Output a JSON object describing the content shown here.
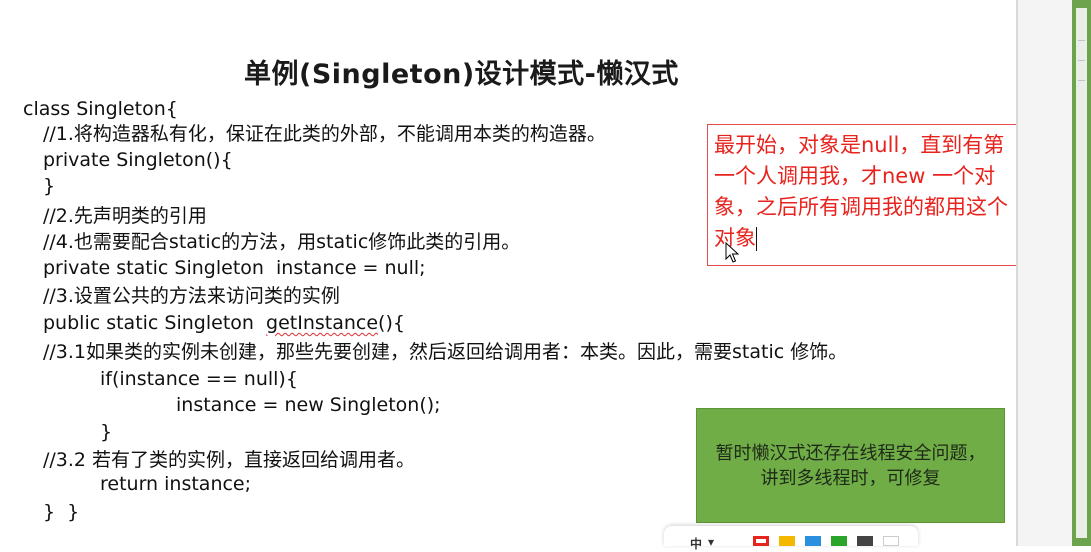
{
  "slide": {
    "title": "单例(Singleton)设计模式-懒汉式",
    "code_lines": [
      "class Singleton{",
      "//1.将构造器私有化，保证在此类的外部，不能调用本类的构造器。",
      "private Singleton(){",
      "}",
      "//2.先声明类的引用",
      "//4.也需要配合static的方法，用static修饰此类的引用。",
      "private static Singleton  instance = null;",
      "//3.设置公共的方法来访问类的实例",
      "public static Singleton  ",
      "getInstance",
      "(){",
      "//3.1如果类的实例未创建，那些先要创建，然后返回给调用者：本类。因此，需要static 修饰。",
      "if(instance == null){",
      "instance = new Singleton();",
      "}",
      "//3.2 若有了类的实例，直接返回给调用者。",
      "return instance;",
      "}  }"
    ]
  },
  "note_box": {
    "lines": [
      "最开始，对象是null，直到有第",
      "一个人调用我，才new 一个对",
      "象，之后所有调用我的都用这个",
      "对象"
    ],
    "color": "#e8231d"
  },
  "green_box": {
    "text": "暂时懒汉式还存在线程安全问题，讲到多线程时，可修复",
    "color": "#70ad47"
  },
  "palette": {
    "ime_label": "中",
    "swatches": [
      "#e8231d",
      "#f5b800",
      "#2b8fe0",
      "#2aa52a",
      "#444444",
      "#ffffff"
    ]
  }
}
